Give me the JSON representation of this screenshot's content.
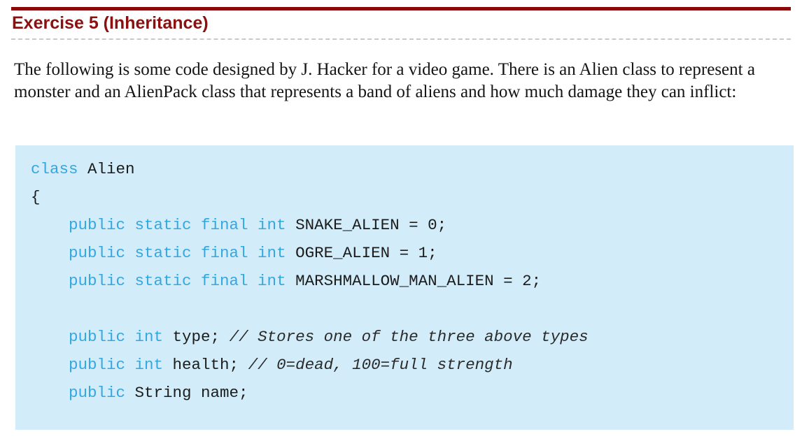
{
  "header": {
    "title": "Exercise 5 (Inheritance)",
    "rule_color": "#8a0808",
    "title_color": "#8c1010",
    "underline_color": "#c9c9c9"
  },
  "intro": {
    "text": "The following is some code designed by J. Hacker for a video game. There is an Alien class to represent a monster and an AlienPack class that represents a band of aliens and how much damage they can inflict:"
  },
  "code": {
    "background_color": "#d2edf9",
    "keyword_color": "#34a6e0",
    "text_color": "#1c1c1c",
    "language": "java",
    "lines": [
      {
        "indent": "",
        "tokens": [
          {
            "type": "kw",
            "text": "class"
          },
          {
            "type": "plain",
            "text": " Alien"
          }
        ]
      },
      {
        "indent": "",
        "tokens": [
          {
            "type": "plain",
            "text": "{"
          }
        ]
      },
      {
        "indent": "    ",
        "tokens": [
          {
            "type": "kw",
            "text": "public static final int"
          },
          {
            "type": "plain",
            "text": " SNAKE_ALIEN = 0;"
          }
        ]
      },
      {
        "indent": "    ",
        "tokens": [
          {
            "type": "kw",
            "text": "public static final int"
          },
          {
            "type": "plain",
            "text": " OGRE_ALIEN = 1;"
          }
        ]
      },
      {
        "indent": "    ",
        "tokens": [
          {
            "type": "kw",
            "text": "public static final int"
          },
          {
            "type": "plain",
            "text": " MARSHMALLOW_MAN_ALIEN = 2;"
          }
        ]
      },
      {
        "indent": "",
        "tokens": []
      },
      {
        "indent": "    ",
        "tokens": [
          {
            "type": "kw",
            "text": "public int"
          },
          {
            "type": "plain",
            "text": " type; "
          },
          {
            "type": "comment",
            "text": "// Stores one of the three above types"
          }
        ]
      },
      {
        "indent": "    ",
        "tokens": [
          {
            "type": "kw",
            "text": "public int"
          },
          {
            "type": "plain",
            "text": " health; "
          },
          {
            "type": "comment",
            "text": "// 0=dead, 100=full strength"
          }
        ]
      },
      {
        "indent": "    ",
        "tokens": [
          {
            "type": "kw",
            "text": "public"
          },
          {
            "type": "plain",
            "text": " String name;"
          }
        ]
      }
    ]
  }
}
